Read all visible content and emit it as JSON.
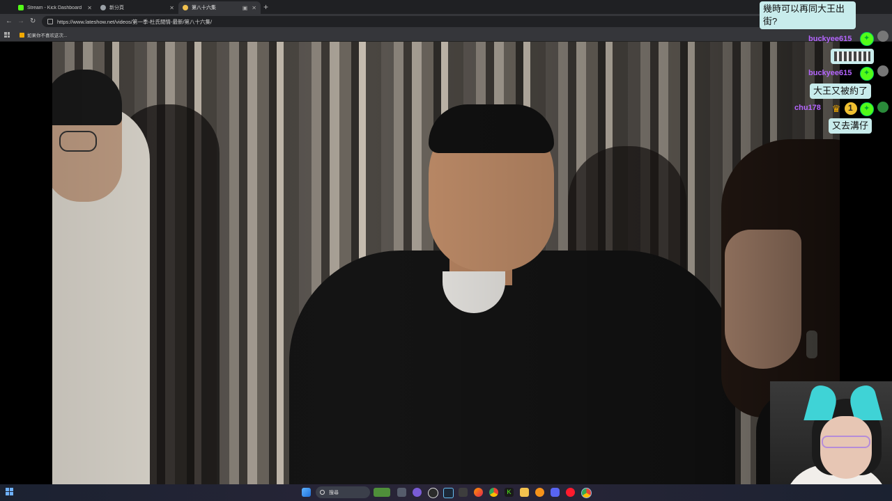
{
  "browser": {
    "tabs": [
      {
        "label": "Stream - Kick Dashboard",
        "favicon_color": "#53fc18",
        "active": false
      },
      {
        "label": "新分頁",
        "favicon_color": "#9aa0a6",
        "active": false
      },
      {
        "label": "第八十六集",
        "favicon_color": "#f2c14e",
        "active": true
      }
    ],
    "url": "https://www.lateshow.net/videos/第一季-杜氏閒情-最新/第八十六集/",
    "bookmark": "如果你不喜欢这次..."
  },
  "chat": {
    "messages": [
      {
        "type": "text",
        "text": "幾時可以再同大王出街?"
      },
      {
        "type": "user",
        "username": "buckyee615"
      },
      {
        "type": "emote"
      },
      {
        "type": "user",
        "username": "buckyee615"
      },
      {
        "type": "text",
        "text": "大王又被約了"
      },
      {
        "type": "user",
        "username": "chu178",
        "badge_number": "1"
      },
      {
        "type": "text",
        "text": "又去溝仔"
      }
    ]
  },
  "taskbar": {
    "search_label": "搜尋"
  },
  "icons": [
    "windows-start-icon",
    "search-icon",
    "ark-icon",
    "task-view-icon",
    "chat-icon",
    "obs-icon",
    "steam-icon",
    "camera-icon",
    "firefox-icon",
    "chrome-icon",
    "kick-icon",
    "folder-icon",
    "bitcoin-icon",
    "discord-icon",
    "opera-icon",
    "chrome-alt-icon"
  ]
}
